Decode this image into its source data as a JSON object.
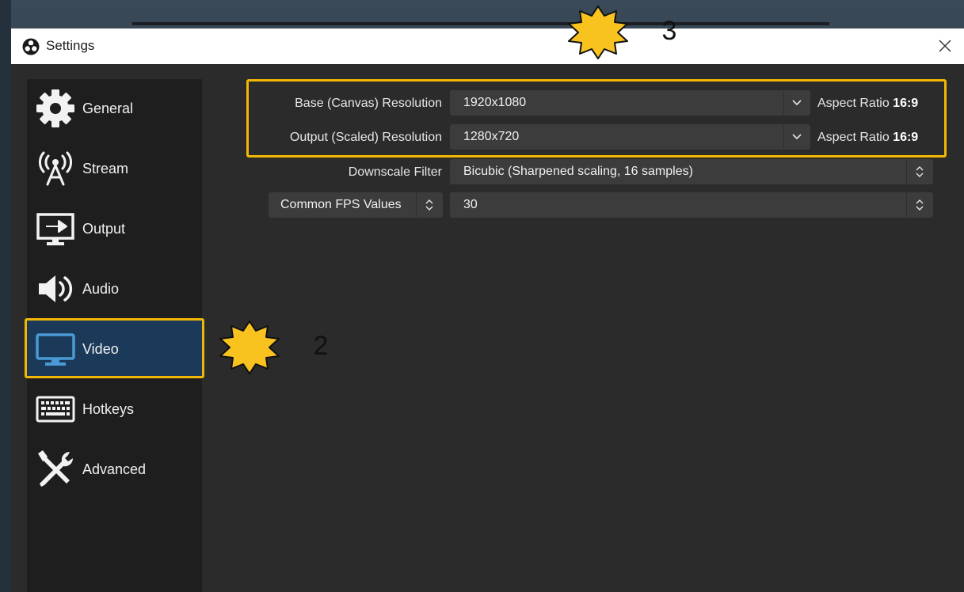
{
  "window": {
    "title": "Settings"
  },
  "sidebar": {
    "items": [
      {
        "key": "general",
        "label": "General"
      },
      {
        "key": "stream",
        "label": "Stream"
      },
      {
        "key": "output",
        "label": "Output"
      },
      {
        "key": "audio",
        "label": "Audio"
      },
      {
        "key": "video",
        "label": "Video",
        "active": true
      },
      {
        "key": "hotkeys",
        "label": "Hotkeys"
      },
      {
        "key": "advanced",
        "label": "Advanced"
      }
    ]
  },
  "video": {
    "base_resolution": {
      "label": "Base (Canvas) Resolution",
      "value": "1920x1080",
      "aspect_prefix": "Aspect Ratio",
      "aspect_value": "16:9"
    },
    "output_resolution": {
      "label": "Output (Scaled) Resolution",
      "value": "1280x720",
      "aspect_prefix": "Aspect Ratio",
      "aspect_value": "16:9"
    },
    "downscale_filter": {
      "label": "Downscale Filter",
      "value": "Bicubic (Sharpened scaling, 16 samples)"
    },
    "fps": {
      "type_label": "Common FPS Values",
      "value": "30"
    }
  },
  "annotations": {
    "badge_video": "2",
    "badge_resolution": "3"
  },
  "colors": {
    "highlight": "#f2b705",
    "active_nav": "#1b3a59",
    "panel": "#2b2b2b",
    "sidebar": "#1e1e1e",
    "field": "#3c3c3c"
  }
}
